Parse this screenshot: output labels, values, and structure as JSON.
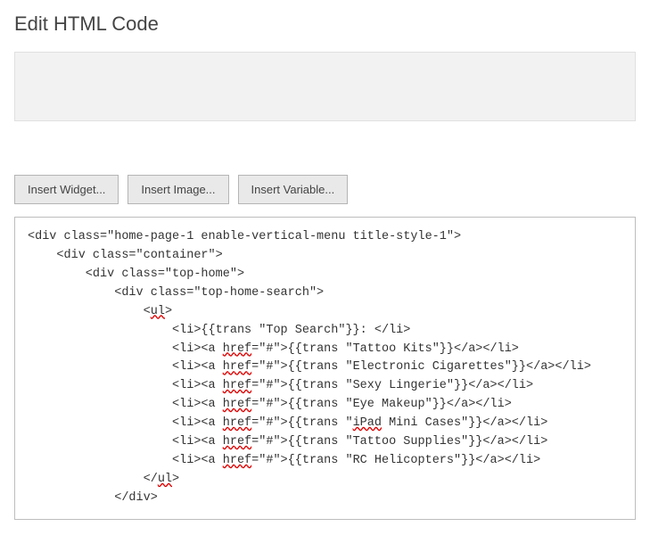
{
  "title": "Edit HTML Code",
  "toolbar": {
    "insert_widget": "Insert Widget...",
    "insert_image": "Insert Image...",
    "insert_variable": "Insert Variable..."
  },
  "code": {
    "lines": [
      "<div class=\"home-page-1 enable-vertical-menu title-style-1\">",
      "    <div class=\"container\">",
      "        <div class=\"top-home\">",
      "            <div class=\"top-home-search\">",
      "                <ul>",
      "                    <li>{{trans \"Top Search\"}}: </li>",
      "                    <li><a href=\"#\">{{trans \"Tattoo Kits\"}}</a></li>",
      "                    <li><a href=\"#\">{{trans \"Electronic Cigarettes\"}}</a></li>",
      "                    <li><a href=\"#\">{{trans \"Sexy Lingerie\"}}</a></li>",
      "                    <li><a href=\"#\">{{trans \"Eye Makeup\"}}</a></li>",
      "                    <li><a href=\"#\">{{trans \"iPad Mini Cases\"}}</a></li>",
      "                    <li><a href=\"#\">{{trans \"Tattoo Supplies\"}}</a></li>",
      "                    <li><a href=\"#\">{{trans \"RC Helicopters\"}}</a></li>",
      "                </ul>",
      "            </div>"
    ]
  },
  "spellcheck_errors": [
    "ul",
    "href",
    "iPad"
  ]
}
